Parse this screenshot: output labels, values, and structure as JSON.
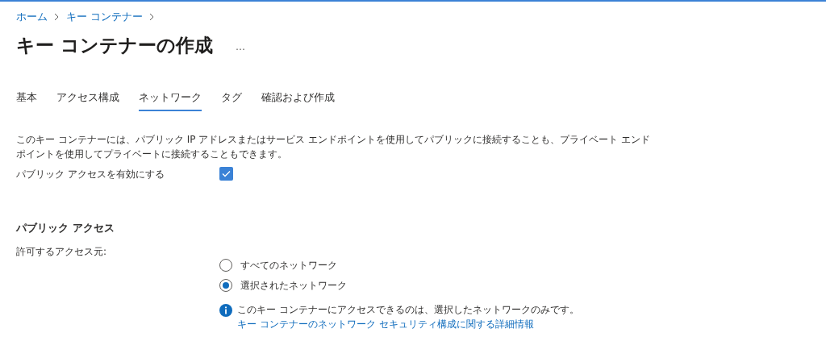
{
  "breadcrumb": [
    {
      "label": "ホーム"
    },
    {
      "label": "キー コンテナー"
    }
  ],
  "title": "キー コンテナーの作成",
  "more": "…",
  "tabs": [
    {
      "label": "基本",
      "selected": false
    },
    {
      "label": "アクセス構成",
      "selected": false
    },
    {
      "label": "ネットワーク",
      "selected": true
    },
    {
      "label": "タグ",
      "selected": false
    },
    {
      "label": "確認および作成",
      "selected": false
    }
  ],
  "description": "このキー コンテナーには、パブリック IP アドレスまたはサービス エンドポイントを使用してパブリックに接続することも、プライベート エンドポイントを使用してプライベートに接続することもできます。",
  "public_access_toggle": {
    "label": "パブリック アクセスを有効にする",
    "checked": true
  },
  "section_heading": "パブリック アクセス",
  "allowed_from": {
    "label": "許可するアクセス元:",
    "options": [
      {
        "label": "すべてのネットワーク",
        "selected": false
      },
      {
        "label": "選択されたネットワーク",
        "selected": true
      }
    ]
  },
  "info": {
    "text": "このキー コンテナーにアクセスできるのは、選択したネットワークのみです。",
    "link": "キー コンテナーのネットワーク セキュリティ構成に関する詳細情報"
  }
}
